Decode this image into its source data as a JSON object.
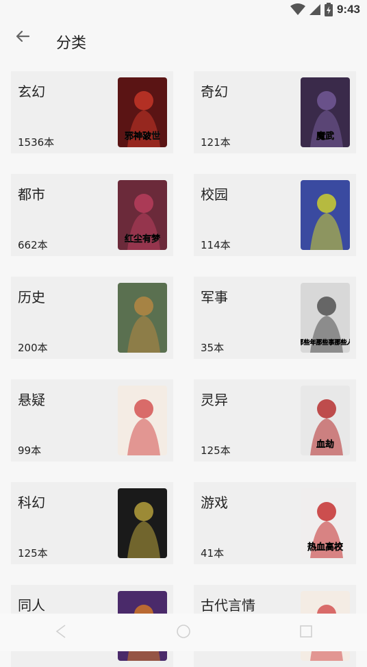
{
  "status_bar": {
    "time": "9:43",
    "icons": [
      "wifi-icon",
      "cell-signal-icon",
      "battery-icon"
    ]
  },
  "header": {
    "title": "分类",
    "back_icon": "arrow-left-icon"
  },
  "categories": [
    {
      "name": "玄幻",
      "count": "1536本",
      "cover": {
        "bg": "#5a1414",
        "accent": "#d23a2a",
        "lettering": "邪神破世"
      }
    },
    {
      "name": "奇幻",
      "count": "121本",
      "cover": {
        "bg": "#3a2a4a",
        "accent": "#7a5fa0",
        "lettering": "魔武"
      }
    },
    {
      "name": "都市",
      "count": "662本",
      "cover": {
        "bg": "#6b2a3a",
        "accent": "#c04060",
        "lettering": "红尘有梦"
      }
    },
    {
      "name": "校园",
      "count": "114本",
      "cover": {
        "bg": "#3a4aa0",
        "accent": "#e0e020",
        "lettering": ""
      }
    },
    {
      "name": "历史",
      "count": "200本",
      "cover": {
        "bg": "#5a7050",
        "accent": "#c08a40",
        "lettering": ""
      }
    },
    {
      "name": "军事",
      "count": "35本",
      "cover": {
        "bg": "#d8d8d8",
        "accent": "#404040",
        "lettering": "那些年那些事那些人"
      }
    },
    {
      "name": "悬疑",
      "count": "99本",
      "cover": {
        "bg": "#f4ece4",
        "accent": "#d04040",
        "lettering": ""
      }
    },
    {
      "name": "灵异",
      "count": "125本",
      "cover": {
        "bg": "#e8e8e8",
        "accent": "#b01818",
        "lettering": "血劫"
      }
    },
    {
      "name": "科幻",
      "count": "125本",
      "cover": {
        "bg": "#1a1a1a",
        "accent": "#c8b040",
        "lettering": ""
      }
    },
    {
      "name": "游戏",
      "count": "41本",
      "cover": {
        "bg": "#f0eeee",
        "accent": "#c01818",
        "lettering": "热血高校"
      }
    },
    {
      "name": "同人",
      "count": "",
      "cover": {
        "bg": "#4a2a6a",
        "accent": "#e08020",
        "lettering": ""
      }
    },
    {
      "name": "古代言情",
      "count": "",
      "cover": {
        "bg": "#f4ece4",
        "accent": "#d04040",
        "lettering": ""
      }
    }
  ],
  "nav_bar": {
    "icons": [
      "back-triangle-icon",
      "home-circle-icon",
      "recents-square-icon"
    ]
  }
}
